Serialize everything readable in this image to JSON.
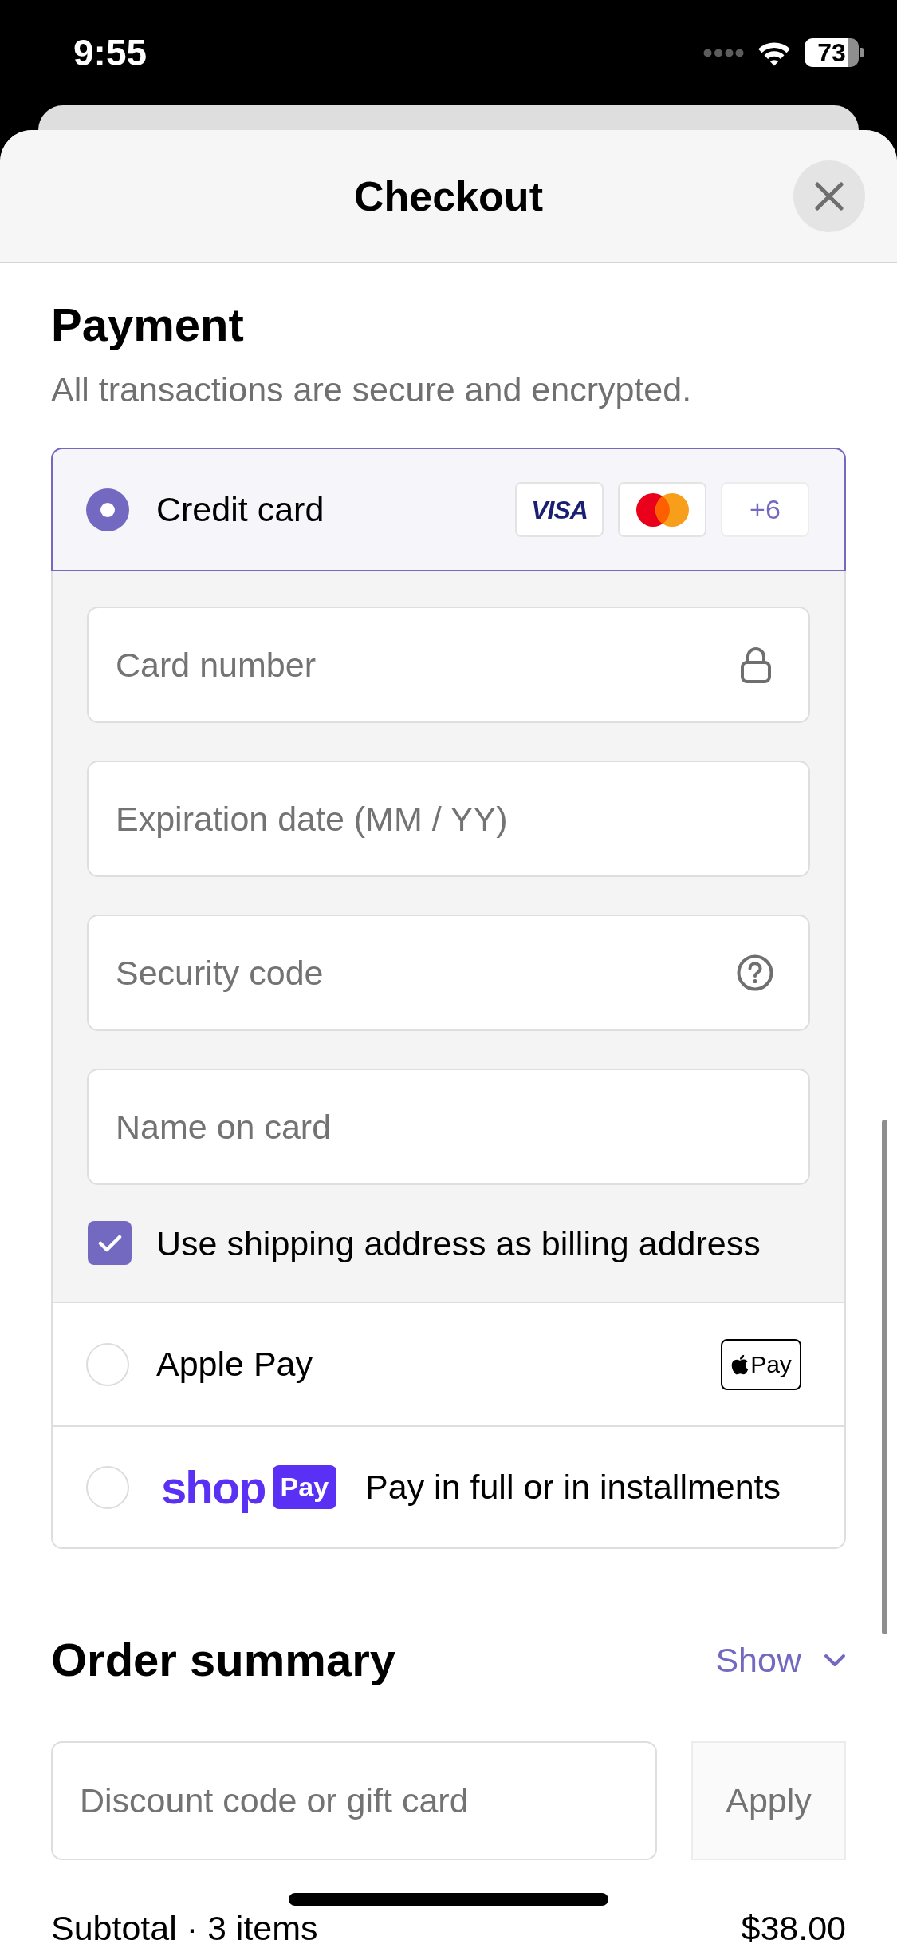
{
  "status_bar": {
    "time": "9:55",
    "battery": "73"
  },
  "header": {
    "title": "Checkout"
  },
  "payment": {
    "title": "Payment",
    "subtitle": "All transactions are secure and encrypted.",
    "methods": [
      {
        "kind": "card",
        "label": "Credit card",
        "selected": true,
        "badges": [
          {
            "kind": "visa",
            "text": "VISA"
          },
          {
            "kind": "mastercard"
          },
          {
            "kind": "count",
            "text": "+6"
          }
        ],
        "fields": [
          {
            "kind": "locked",
            "placeholder": "Card number"
          },
          {
            "kind": "plain",
            "placeholder": "Expiration date (MM / YY)"
          },
          {
            "kind": "help",
            "placeholder": "Security code"
          },
          {
            "kind": "plain",
            "placeholder": "Name on card"
          }
        ],
        "billing_checkbox": {
          "label": "Use shipping address as billing address",
          "checked": true
        }
      },
      {
        "kind": "wallet",
        "label": "Apple Pay",
        "badge": "Pay",
        "selected": false
      },
      {
        "kind": "shop",
        "logo": "shop",
        "logo_badge": "Pay",
        "label": "Pay in full or in installments",
        "selected": false
      }
    ]
  },
  "order_summary": {
    "title": "Order summary",
    "toggle": {
      "label": "Show",
      "expanded": false
    },
    "discount": {
      "placeholder": "Discount code or gift card",
      "button": "Apply",
      "disabled": true
    },
    "subtotal": {
      "label": "Subtotal · 3 items",
      "value": "$38.00"
    }
  }
}
